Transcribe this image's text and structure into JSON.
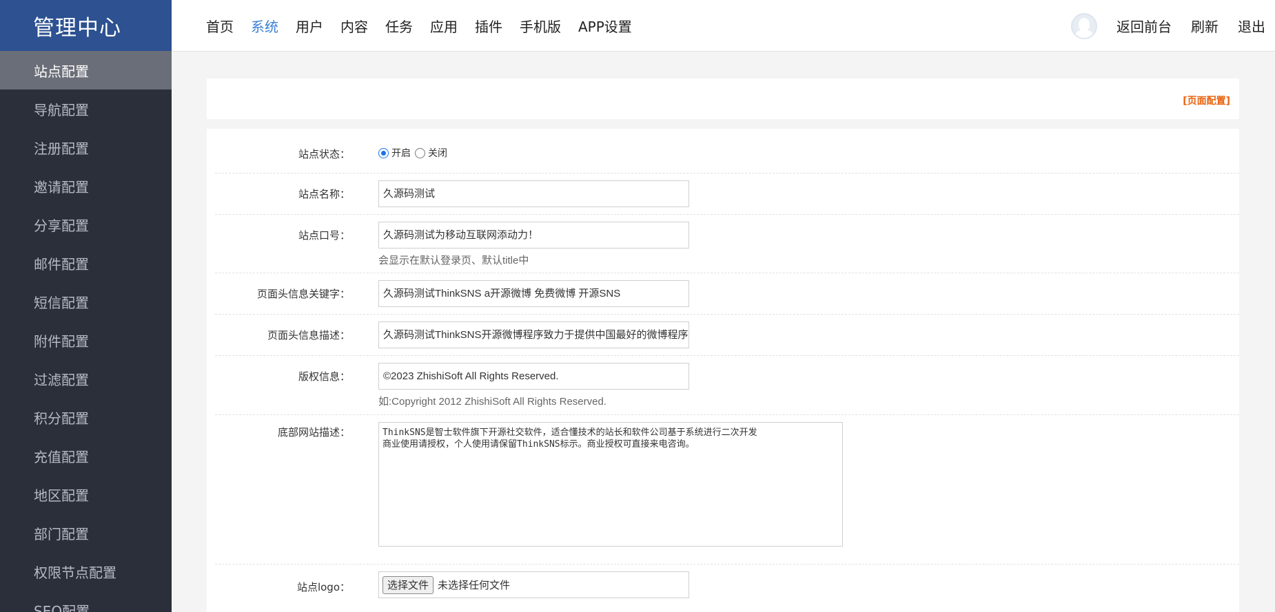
{
  "sidebar": {
    "brand": "管理中心",
    "items": [
      {
        "label": "站点配置",
        "active": true
      },
      {
        "label": "导航配置"
      },
      {
        "label": "注册配置"
      },
      {
        "label": "邀请配置"
      },
      {
        "label": "分享配置"
      },
      {
        "label": "邮件配置"
      },
      {
        "label": "短信配置"
      },
      {
        "label": "附件配置"
      },
      {
        "label": "过滤配置"
      },
      {
        "label": "积分配置"
      },
      {
        "label": "充值配置"
      },
      {
        "label": "地区配置"
      },
      {
        "label": "部门配置"
      },
      {
        "label": "权限节点配置"
      },
      {
        "label": "SEO配置"
      }
    ]
  },
  "topnav": {
    "items": [
      {
        "label": "首页"
      },
      {
        "label": "系统",
        "active": true
      },
      {
        "label": "用户"
      },
      {
        "label": "内容"
      },
      {
        "label": "任务"
      },
      {
        "label": "应用"
      },
      {
        "label": "插件"
      },
      {
        "label": "手机版"
      },
      {
        "label": "APP设置"
      }
    ],
    "right": {
      "back": "返回前台",
      "refresh": "刷新",
      "logout": "退出"
    }
  },
  "page_config": "[页面配置]",
  "form": {
    "status": {
      "label": "站点状态：",
      "on": "开启",
      "off": "关闭",
      "value": "开启"
    },
    "site_name": {
      "label": "站点名称：",
      "value": "久源码测试"
    },
    "slogan": {
      "label": "站点口号：",
      "value": "久源码测试为移动互联网添动力！",
      "hint": "会显示在默认登录页、默认title中"
    },
    "keywords": {
      "label": "页面头信息关键字：",
      "value": "久源码测试ThinkSNS a开源微博 免费微博 开源SNS"
    },
    "description": {
      "label": "页面头信息描述：",
      "value": "久源码测试ThinkSNS开源微博程序致力于提供中国最好的微博程序"
    },
    "copyright": {
      "label": "版权信息：",
      "value": "©2023 ZhishiSoft All Rights Reserved.",
      "hint": "如:Copyright 2012 ZhishiSoft All Rights Reserved."
    },
    "footer": {
      "label": "底部网站描述：",
      "value": "ThinkSNS是智士软件旗下开源社交软件，适合懂技术的站长和软件公司基于系统进行二次开发\n商业使用请授权，个人使用请保留ThinkSNS标示。商业授权可直接来电咨询。"
    },
    "logo": {
      "label": "站点logo：",
      "button": "选择文件",
      "status": "未选择任何文件"
    }
  },
  "colors": {
    "brand_bg": "#2d5191",
    "sidebar_bg": "#2b2f3a",
    "active_item_bg": "#6a6e78",
    "nav_active": "#3b7fd6",
    "page_config": "#e8630e"
  }
}
